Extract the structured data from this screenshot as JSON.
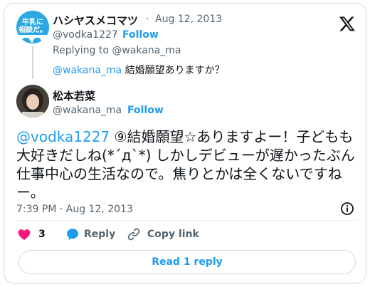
{
  "quoted": {
    "avatar_text_line1": "牛乳に",
    "avatar_text_line2": "相談だ。",
    "name": "ハシヤスメコマツ",
    "dot": "·",
    "date": "Aug 12, 2013",
    "handle": "@vodka1227",
    "follow_label": "Follow",
    "replying_to": "Replying to @wakana_ma",
    "text_mention": "@wakana_ma",
    "text_body": " 結婚願望ありますか？"
  },
  "tweet": {
    "name": "松本若菜",
    "handle": "@wakana_ma",
    "dot": "·",
    "follow_label": "Follow",
    "text_mention": "@vodka1227",
    "text_body": " ⑨結婚願望☆ありますよー！子どもも大好きだしね(*´д`*) しかしデビューが遅かったぶん仕事中心の生活なので。焦りとかは全くないですねー。",
    "timestamp": "7:39 PM · Aug 12, 2013"
  },
  "actions": {
    "like_count": "3",
    "reply_label": "Reply",
    "copy_link_label": "Copy link"
  },
  "read_replies_label": "Read 1 reply",
  "colors": {
    "accent": "#1d9bf0",
    "like": "#f91880",
    "text": "#0f1419",
    "secondary": "#536471",
    "border": "#cfd9de"
  },
  "icons": [
    "x-logo-icon",
    "info-icon",
    "heart-icon",
    "reply-bubble-icon",
    "link-icon"
  ]
}
